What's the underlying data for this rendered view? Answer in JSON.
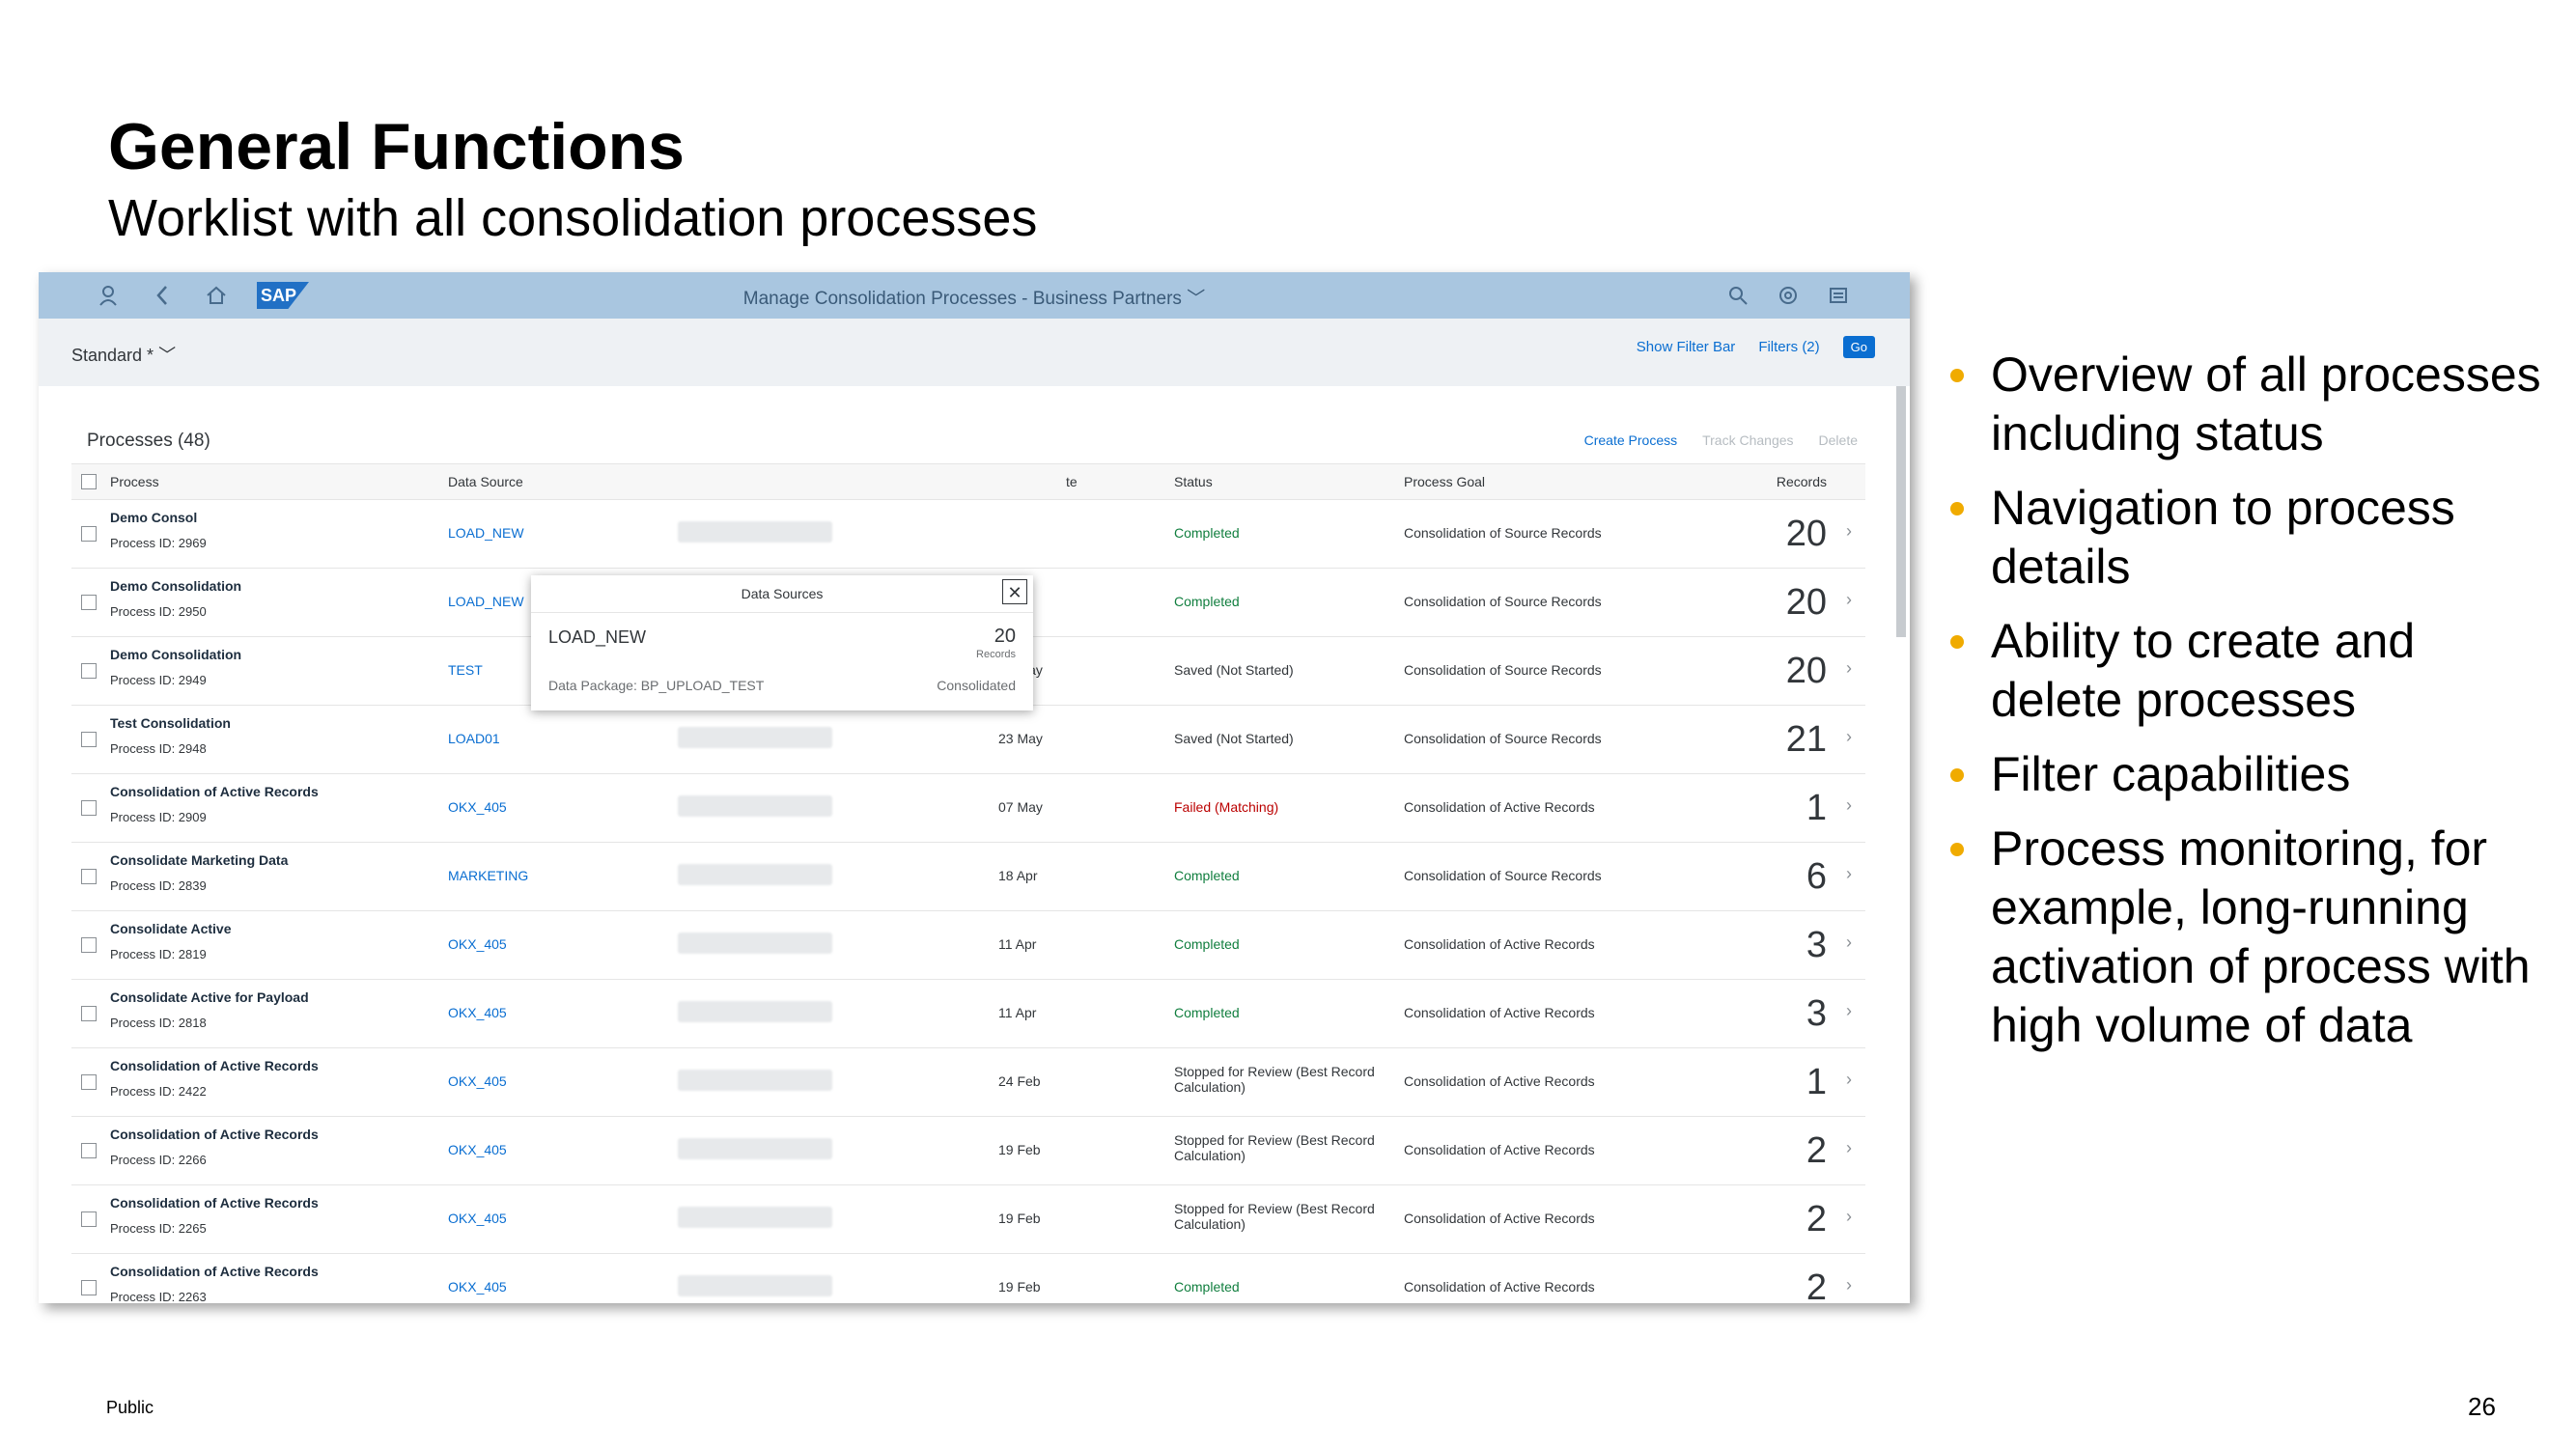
{
  "slide": {
    "title": "General Functions",
    "subtitle": "Worklist with all consolidation processes",
    "footer": "Public",
    "page_number": "26",
    "bullets": [
      "Overview of all processes including status",
      "Navigation to process details",
      "Ability to create and delete processes",
      "Filter capabilities",
      "Process monitoring, for example, long-running activation of process with high volume of data"
    ]
  },
  "app": {
    "shell_title": "Manage Consolidation Processes - Business Partners",
    "logo": "SAP",
    "variant": "Standard *",
    "show_filter_bar": "Show Filter Bar",
    "filters": "Filters (2)",
    "go": "Go",
    "table_title": "Processes (48)",
    "toolbar": {
      "create": "Create Process",
      "track": "Track Changes",
      "delete": "Delete"
    },
    "columns": {
      "process": "Process",
      "data_source": "Data Source",
      "date": "te",
      "status": "Status",
      "goal": "Process Goal",
      "records": "Records"
    },
    "rows": [
      {
        "name": "Demo Consol",
        "id": "Process ID: 2969",
        "ds": "LOAD_NEW",
        "date": "",
        "status": "Completed",
        "status_type": "completed",
        "goal": "Consolidation of Source Records",
        "records": "20"
      },
      {
        "name": "Demo Consolidation",
        "id": "Process ID: 2950",
        "ds": "LOAD_NEW",
        "date": "",
        "status": "Completed",
        "status_type": "completed",
        "goal": "Consolidation of Source Records",
        "records": "20"
      },
      {
        "name": "Demo Consolidation",
        "id": "Process ID: 2949",
        "ds": "TEST",
        "date": "23 May",
        "status": "Saved (Not Started)",
        "status_type": "saved",
        "goal": "Consolidation of Source Records",
        "records": "20"
      },
      {
        "name": "Test Consolidation",
        "id": "Process ID: 2948",
        "ds": "LOAD01",
        "date": "23 May",
        "status": "Saved (Not Started)",
        "status_type": "saved",
        "goal": "Consolidation of Source Records",
        "records": "21"
      },
      {
        "name": "Consolidation of Active Records",
        "id": "Process ID: 2909",
        "ds": "OKX_405",
        "date": "07 May",
        "status": "Failed (Matching)",
        "status_type": "failed",
        "goal": "Consolidation of Active Records",
        "records": "1"
      },
      {
        "name": "Consolidate Marketing Data",
        "id": "Process ID: 2839",
        "ds": "MARKETING",
        "date": "18 Apr",
        "status": "Completed",
        "status_type": "completed",
        "goal": "Consolidation of Source Records",
        "records": "6"
      },
      {
        "name": "Consolidate Active",
        "id": "Process ID: 2819",
        "ds": "OKX_405",
        "date": "11 Apr",
        "status": "Completed",
        "status_type": "completed",
        "goal": "Consolidation of Active Records",
        "records": "3"
      },
      {
        "name": "Consolidate Active for Payload",
        "id": "Process ID: 2818",
        "ds": "OKX_405",
        "date": "11 Apr",
        "status": "Completed",
        "status_type": "completed",
        "goal": "Consolidation of Active Records",
        "records": "3"
      },
      {
        "name": "Consolidation of Active Records",
        "id": "Process ID: 2422",
        "ds": "OKX_405",
        "date": "24 Feb",
        "status": "Stopped for Review (Best Record Calculation)",
        "status_type": "saved",
        "goal": "Consolidation of Active Records",
        "records": "1"
      },
      {
        "name": "Consolidation of Active Records",
        "id": "Process ID: 2266",
        "ds": "OKX_405",
        "date": "19 Feb",
        "status": "Stopped for Review (Best Record Calculation)",
        "status_type": "saved",
        "goal": "Consolidation of Active Records",
        "records": "2"
      },
      {
        "name": "Consolidation of Active Records",
        "id": "Process ID: 2265",
        "ds": "OKX_405",
        "date": "19 Feb",
        "status": "Stopped for Review (Best Record Calculation)",
        "status_type": "saved",
        "goal": "Consolidation of Active Records",
        "records": "2"
      },
      {
        "name": "Consolidation of Active Records",
        "id": "Process ID: 2263",
        "ds": "OKX_405",
        "date": "19 Feb",
        "status": "Completed",
        "status_type": "completed",
        "goal": "Consolidation of Active Records",
        "records": "2"
      }
    ],
    "popover": {
      "title": "Data Sources",
      "name": "LOAD_NEW",
      "count": "20",
      "count_label": "Records",
      "package": "Data Package: BP_UPLOAD_TEST",
      "state": "Consolidated"
    }
  }
}
